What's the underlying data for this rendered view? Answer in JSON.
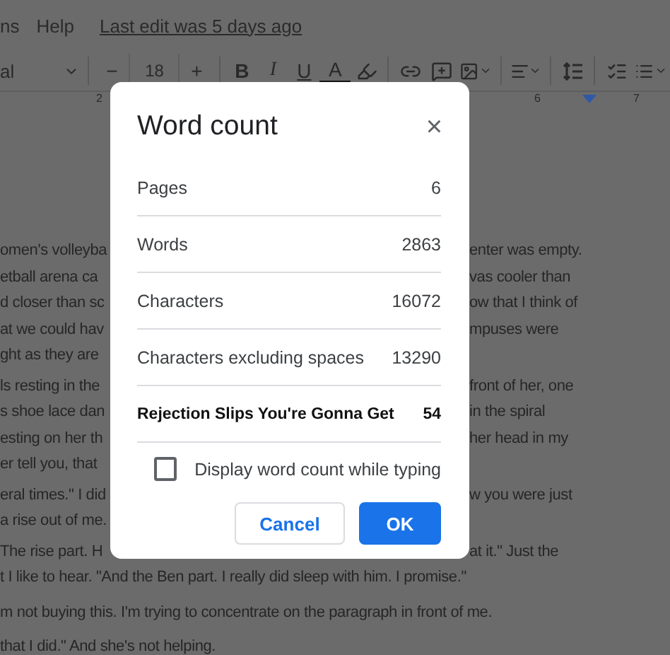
{
  "menu_bar": {
    "items": [
      "ns",
      "Help"
    ],
    "last_edit": "Last edit was 5 days ago"
  },
  "toolbar": {
    "font": "al",
    "font_size": "18",
    "minus": "−",
    "plus": "+",
    "bold": "B",
    "italic": "I",
    "underline": "U",
    "text_color": "A"
  },
  "ruler": {
    "marks": [
      "2",
      "6",
      "7"
    ]
  },
  "document": {
    "paragraphs": [
      {
        "lines": [
          {
            "left": "omen's volleyba",
            "right": "enter was empty."
          },
          {
            "left": "etball arena ca",
            "right": "vas cooler than"
          },
          {
            "left": "d closer than sc",
            "right": "ow that I think of"
          },
          {
            "left": "at we could hav",
            "right": "mpuses were"
          },
          {
            "left": "ght as they are"
          }
        ]
      },
      {
        "lines": [
          {
            "left": "ls resting in the",
            "right": "front of her, one"
          },
          {
            "left": "s shoe lace dan",
            "right": "in the spiral"
          },
          {
            "left": "esting on her th",
            "right": "her head in my"
          },
          {
            "left": "er tell you, that"
          }
        ]
      },
      {
        "lines": [
          {
            "left": "eral times.\" I did",
            "right": "w you were just"
          },
          {
            "left": "a rise out of me."
          }
        ]
      },
      {
        "lines": [
          {
            "left": "The rise part. H",
            "right": "at it.\" Just the"
          },
          {
            "full": "t I like to hear. \"And the Ben part. I really did sleep with him. I promise.\""
          }
        ]
      },
      {
        "lines": [
          {
            "full": "m not buying this. I'm trying to concentrate on the paragraph in front of me."
          }
        ]
      },
      {
        "lines": [
          {
            "full": "that I did.\" And she's not helping."
          }
        ]
      }
    ]
  },
  "dialog": {
    "title": "Word count",
    "close": "×",
    "rows": [
      {
        "label": "Pages",
        "value": "6",
        "kind": "stat"
      },
      {
        "label": "Words",
        "value": "2863",
        "kind": "stat"
      },
      {
        "label": "Characters",
        "value": "16072",
        "kind": "stat"
      },
      {
        "label": "Characters excluding spaces",
        "value": "13290",
        "kind": "stat"
      },
      {
        "label": "Rejection Slips You're Gonna Get",
        "value": "54",
        "kind": "custom"
      }
    ],
    "checkbox": {
      "label": "Display word count while typing",
      "checked": false
    },
    "buttons": [
      {
        "label": "Cancel",
        "kind": "secondary"
      },
      {
        "label": "OK",
        "kind": "primary"
      }
    ]
  }
}
